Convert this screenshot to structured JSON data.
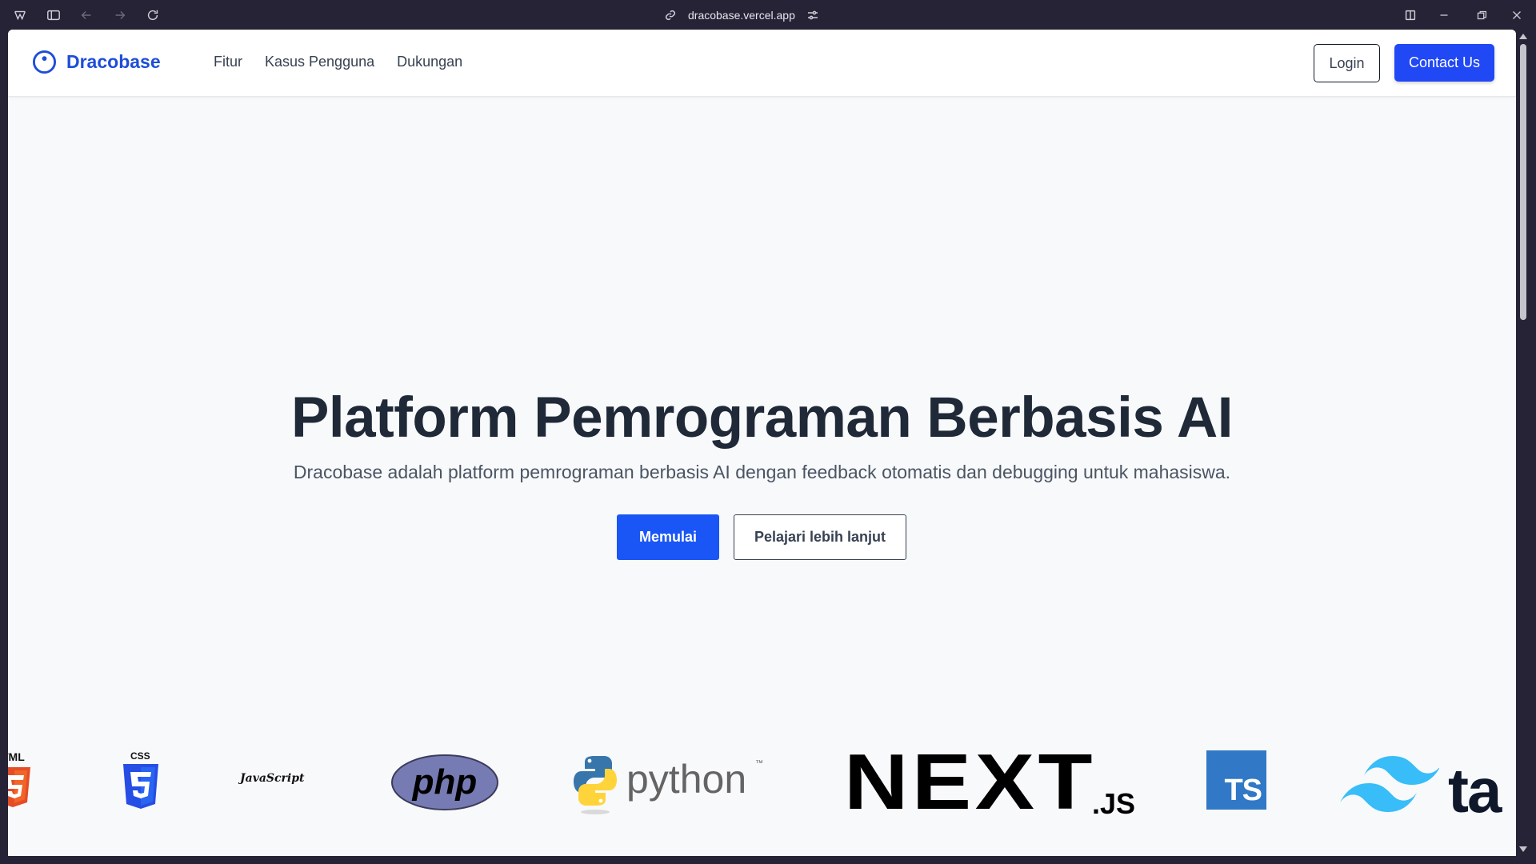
{
  "browser": {
    "url": "dracobase.vercel.app"
  },
  "nav": {
    "brand": "Dracobase",
    "links": [
      "Fitur",
      "Kasus Pengguna",
      "Dukungan"
    ],
    "login_label": "Login",
    "contact_label": "Contact Us"
  },
  "hero": {
    "title": "Platform Pemrograman Berbasis AI",
    "subtitle": "Dracobase adalah platform pemrograman berbasis AI dengan feedback otomatis dan debugging untuk mahasiswa.",
    "primary_button": "Memulai",
    "secondary_button": "Pelajari lebih lanjut"
  },
  "tech_logos": {
    "html_text": "TML",
    "css_text": "CSS",
    "js_text": "JavaScript",
    "php_text": "php",
    "python_text": "python",
    "python_tm": "™",
    "next_text": "NEXT",
    "next_sub": ".JS",
    "ts_text": "TS",
    "tailwind_text": "ta"
  },
  "colors": {
    "brand": "#1d4ed8",
    "primary": "#1a56f5",
    "contact": "#2148f5",
    "heading": "#1f2937",
    "page_bg": "#f8f9fb",
    "chrome_bg": "#262336"
  }
}
